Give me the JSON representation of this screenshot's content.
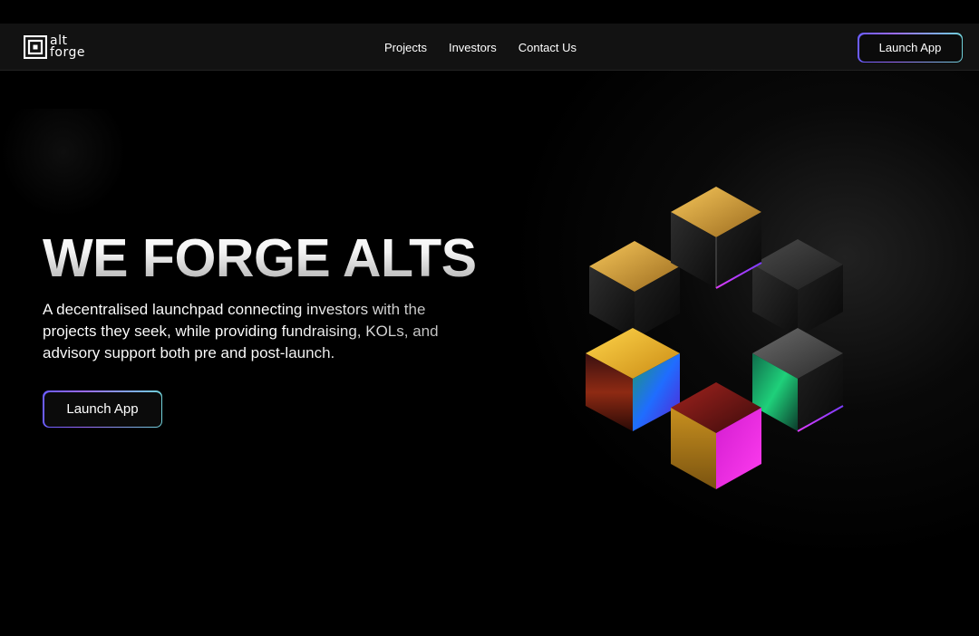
{
  "brand": {
    "logo_line1": "alt",
    "logo_line2": "forge"
  },
  "nav": {
    "links": [
      "Projects",
      "Investors",
      "Contact Us"
    ],
    "cta_label": "Launch App"
  },
  "hero": {
    "title": "WE FORGE ALTS",
    "description": "A decentralised launchpad connecting investors with the projects they seek, while providing fundraising, KOLs, and advisory support both pre and post-launch.",
    "cta_label": "Launch App"
  },
  "colors": {
    "background": "#000000",
    "navbar": "#121212",
    "button_gradient_start": "#6a5cff",
    "button_gradient_end": "#6fd0d8"
  },
  "icons": {
    "logo": "alt-forge-logo-mark",
    "hero_art": "hexagonal-ring-of-iridescent-cubes"
  }
}
